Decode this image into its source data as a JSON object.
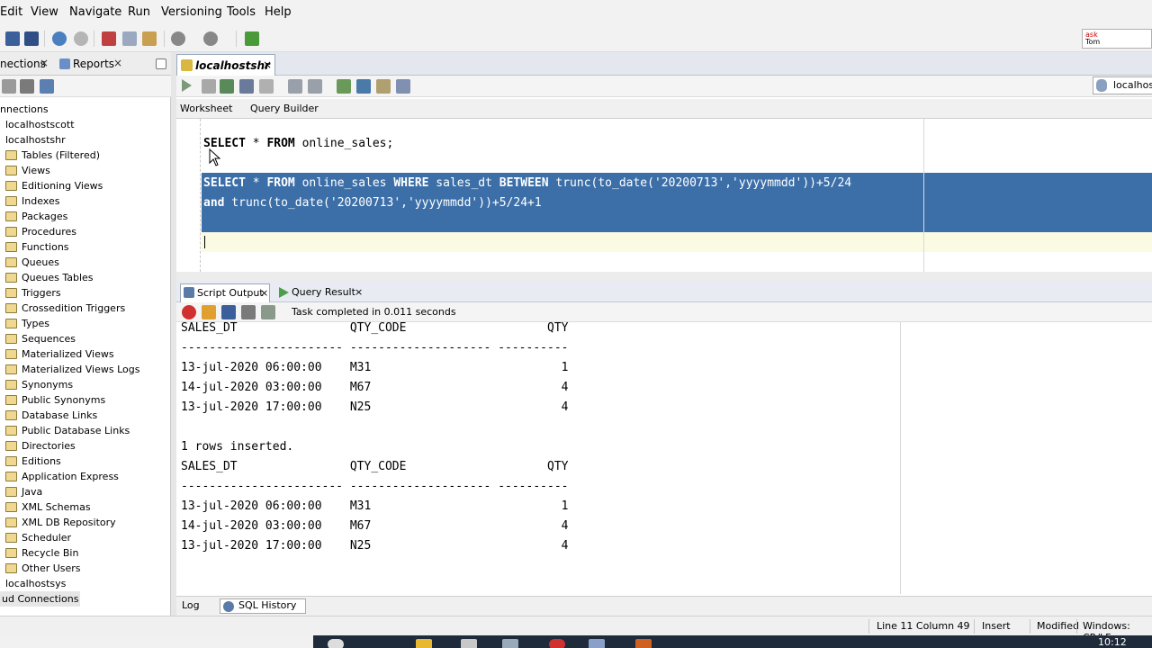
{
  "menu": [
    "Edit",
    "View",
    "Navigate",
    "Run",
    "Versioning",
    "Tools",
    "Help"
  ],
  "ask_box": {
    "line1": "ask",
    "line2": "Tom"
  },
  "left_panel": {
    "tabs": [
      "nections",
      "Reports"
    ],
    "close_glyph": "×",
    "tree": [
      {
        "label": "nnections",
        "level": 0,
        "icon": false
      },
      {
        "label": "localhostscott",
        "level": 1,
        "icon": false
      },
      {
        "label": "localhostshr",
        "level": 1,
        "icon": false
      },
      {
        "label": "Tables (Filtered)",
        "level": 2,
        "icon": true
      },
      {
        "label": "Views",
        "level": 2,
        "icon": true
      },
      {
        "label": "Editioning Views",
        "level": 2,
        "icon": true
      },
      {
        "label": "Indexes",
        "level": 2,
        "icon": true
      },
      {
        "label": "Packages",
        "level": 2,
        "icon": true
      },
      {
        "label": "Procedures",
        "level": 2,
        "icon": true
      },
      {
        "label": "Functions",
        "level": 2,
        "icon": true
      },
      {
        "label": "Queues",
        "level": 2,
        "icon": true
      },
      {
        "label": "Queues Tables",
        "level": 2,
        "icon": true
      },
      {
        "label": "Triggers",
        "level": 2,
        "icon": true
      },
      {
        "label": "Crossedition Triggers",
        "level": 2,
        "icon": true
      },
      {
        "label": "Types",
        "level": 2,
        "icon": true
      },
      {
        "label": "Sequences",
        "level": 2,
        "icon": true
      },
      {
        "label": "Materialized Views",
        "level": 2,
        "icon": true
      },
      {
        "label": "Materialized Views Logs",
        "level": 2,
        "icon": true
      },
      {
        "label": "Synonyms",
        "level": 2,
        "icon": true
      },
      {
        "label": "Public Synonyms",
        "level": 2,
        "icon": true
      },
      {
        "label": "Database Links",
        "level": 2,
        "icon": true
      },
      {
        "label": "Public Database Links",
        "level": 2,
        "icon": true
      },
      {
        "label": "Directories",
        "level": 2,
        "icon": true
      },
      {
        "label": "Editions",
        "level": 2,
        "icon": true
      },
      {
        "label": "Application Express",
        "level": 2,
        "icon": true
      },
      {
        "label": "Java",
        "level": 2,
        "icon": true
      },
      {
        "label": "XML Schemas",
        "level": 2,
        "icon": true
      },
      {
        "label": "XML DB Repository",
        "level": 2,
        "icon": true
      },
      {
        "label": "Scheduler",
        "level": 2,
        "icon": true
      },
      {
        "label": "Recycle Bin",
        "level": 2,
        "icon": true
      },
      {
        "label": "Other Users",
        "level": 2,
        "icon": true
      },
      {
        "label": "localhostsys",
        "level": 1,
        "icon": false
      },
      {
        "label": "ud Connections",
        "level": 0,
        "icon": false,
        "selected": true
      }
    ]
  },
  "editor": {
    "doc_tab": "localhostshr",
    "connection": "localhost",
    "worksheet_tabs": [
      "Worksheet",
      "Query Builder"
    ],
    "code": {
      "line1": [
        {
          "t": "SELECT",
          "kw": true
        },
        {
          "t": " * "
        },
        {
          "t": "FROM",
          "kw": true
        },
        {
          "t": " online_sales;"
        }
      ],
      "line2": [
        {
          "t": "SELECT",
          "kw": true
        },
        {
          "t": " * "
        },
        {
          "t": "FROM",
          "kw": true
        },
        {
          "t": " online_sales "
        },
        {
          "t": "WHERE",
          "kw": true
        },
        {
          "t": " sales_dt "
        },
        {
          "t": "BETWEEN",
          "kw": true
        },
        {
          "t": " trunc(to_date('20200713','yyyymmdd'))+5/24"
        }
      ],
      "line3": [
        {
          "t": "and",
          "kw": true
        },
        {
          "t": " trunc(to_date('20200713','yyyymmdd'))+5/24+1"
        }
      ]
    }
  },
  "output": {
    "tabs": [
      "Script Output",
      "Query Result"
    ],
    "status": "Task completed in 0.011 seconds",
    "lines": [
      "SALES_DT                QTY_CODE                    QTY",
      "----------------------- -------------------- ----------",
      "13-jul-2020 06:00:00    M31                           1",
      "14-jul-2020 03:00:00    M67                           4",
      "13-jul-2020 17:00:00    N25                           4",
      "",
      "1 rows inserted.",
      "SALES_DT                QTY_CODE                    QTY",
      "----------------------- -------------------- ----------",
      "13-jul-2020 06:00:00    M31                           1",
      "14-jul-2020 03:00:00    M67                           4",
      "13-jul-2020 17:00:00    N25                           4"
    ]
  },
  "bottom_tabs": [
    "Log",
    "SQL History"
  ],
  "statusbar": {
    "position": "Line 11 Column 49",
    "mode": "Insert",
    "state": "Modified",
    "encoding": "Windows: CR/LF"
  },
  "clock": "10:12"
}
